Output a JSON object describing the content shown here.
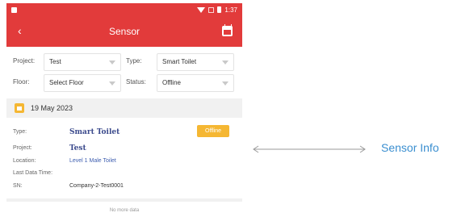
{
  "status_bar": {
    "time": "1:37"
  },
  "nav": {
    "back_icon": "chevron-left-icon",
    "title": "Sensor",
    "calendar_icon": "calendar-icon"
  },
  "filters": {
    "project": {
      "label": "Project:",
      "value": "Test"
    },
    "type": {
      "label": "Type:",
      "value": "Smart Toilet"
    },
    "floor": {
      "label": "Floor:",
      "value": "Select Floor"
    },
    "status": {
      "label": "Status:",
      "value": "Offline"
    }
  },
  "date_bar": {
    "icon": "calendar-icon",
    "date": "19 May 2023"
  },
  "card": {
    "type_label": "Type:",
    "type_value": "Smart Toilet",
    "status_badge": "Offline",
    "project_label": "Project:",
    "project_value": "Test",
    "location_label": "Location:",
    "location_value": "Level 1 Male Toilet",
    "last_data_label": "Last Data Time:",
    "last_data_value": "",
    "sn_label": "SN:",
    "sn_value": "Company-2-Test0001"
  },
  "footer": {
    "text": "No more data"
  },
  "annotation": {
    "label": "Sensor Info"
  },
  "colors": {
    "brand": "#e23b3b",
    "badge": "#f5b733",
    "annotation": "#3b8fd0"
  }
}
